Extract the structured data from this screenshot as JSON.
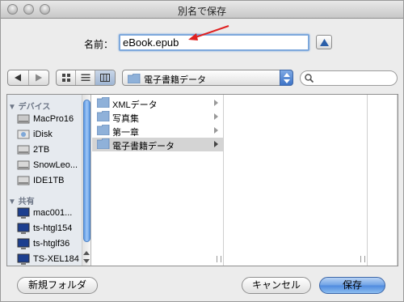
{
  "window": {
    "title": "別名で保存"
  },
  "save_as": {
    "label": "名前：",
    "value": "eBook.epub"
  },
  "toolbar": {
    "path_popup": "電子書籍データ",
    "search_placeholder": ""
  },
  "sidebar": {
    "sections": [
      {
        "label": "▼ デバイス",
        "items": [
          {
            "label": "MacPro16",
            "icon": "hard-drive-icon"
          },
          {
            "label": "iDisk",
            "icon": "idisk-icon"
          },
          {
            "label": "2TB",
            "icon": "hard-drive-icon"
          },
          {
            "label": "SnowLeo...",
            "icon": "hard-drive-icon"
          },
          {
            "label": "IDE1TB",
            "icon": "hard-drive-icon"
          }
        ]
      },
      {
        "label": "▼ 共有",
        "items": [
          {
            "label": "mac001...",
            "icon": "computer-icon"
          },
          {
            "label": "ts-htgl154",
            "icon": "computer-icon"
          },
          {
            "label": "ts-htglf36",
            "icon": "computer-icon"
          },
          {
            "label": "TS-XEL184",
            "icon": "computer-icon"
          }
        ]
      }
    ]
  },
  "column1": {
    "items": [
      {
        "label": "XMLデータ",
        "selected": false
      },
      {
        "label": "写真集",
        "selected": false
      },
      {
        "label": "第一章",
        "selected": false
      },
      {
        "label": "電子書籍データ",
        "selected": true
      }
    ]
  },
  "buttons": {
    "new_folder": "新規フォルダ",
    "cancel": "キャンセル",
    "save": "保存"
  },
  "colors": {
    "accent": "#4f8ade",
    "focus_ring": "#7da8dc",
    "annotation_arrow": "#e02020",
    "folder": "#8fb1d9"
  }
}
